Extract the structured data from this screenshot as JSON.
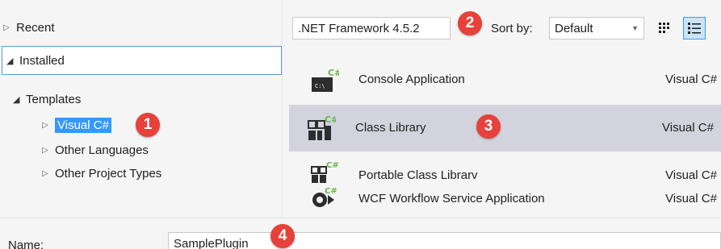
{
  "tree": {
    "recent": "Recent",
    "installed": "Installed",
    "templates": "Templates",
    "visual_csharp": "Visual C#",
    "other_languages": "Other Languages",
    "other_project_types": "Other Project Types"
  },
  "toolbar": {
    "framework": ".NET Framework 4.5.2",
    "sort_by_label": "Sort by:",
    "sort_value": "Default"
  },
  "templates": [
    {
      "name": "Console Application",
      "language": "Visual C#",
      "icon": "console-app-icon"
    },
    {
      "name": "Class Library",
      "language": "Visual C#",
      "icon": "class-library-icon",
      "selected": true
    },
    {
      "name": "Portable Class Librarv",
      "language": "Visual C#",
      "icon": "portable-class-library-icon"
    },
    {
      "name": "WCF Workflow Service Application",
      "language": "Visual C#",
      "icon": "wcf-workflow-icon"
    }
  ],
  "name_field": {
    "label": "Name:",
    "value": "SamplePlugin"
  },
  "badges": [
    "1",
    "2",
    "3",
    "4"
  ],
  "colors": {
    "badge": "#e8403a",
    "selection": "#3399ff",
    "selected_row": "#d3d3de",
    "csharp_green": "#68b346"
  }
}
